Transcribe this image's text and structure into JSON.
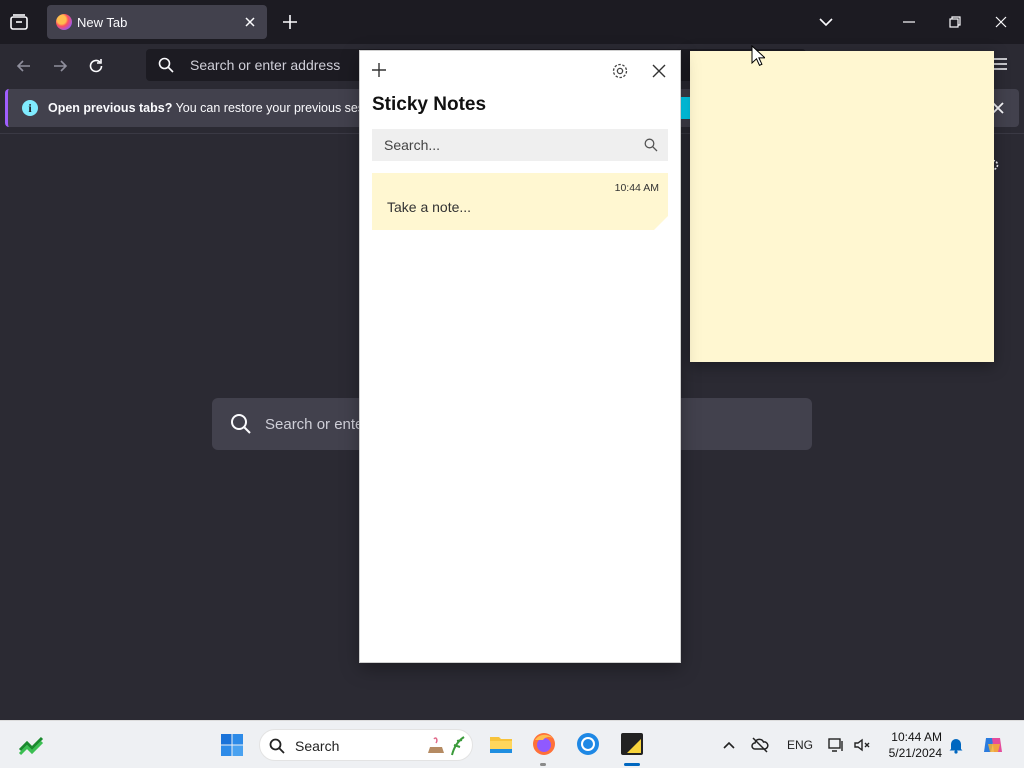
{
  "browser": {
    "tab_title": "New Tab",
    "url_placeholder": "Search or enter address",
    "infobar": {
      "title": "Open previous tabs?",
      "message": "You can restore your previous session f"
    },
    "page_search_placeholder": "Search or ente"
  },
  "sticky_notes": {
    "title": "Sticky Notes",
    "search_placeholder": "Search...",
    "notes": [
      {
        "time": "10:44 AM",
        "text": "Take a note..."
      }
    ],
    "colors": {
      "note_bg": "#fff7d1",
      "window_bg": "#ffffff"
    }
  },
  "taskbar": {
    "search_label": "Search",
    "language": "ENG",
    "time": "10:44 AM",
    "date": "5/21/2024",
    "apps": [
      "file-explorer",
      "firefox",
      "chrome",
      "sticky-notes"
    ]
  }
}
